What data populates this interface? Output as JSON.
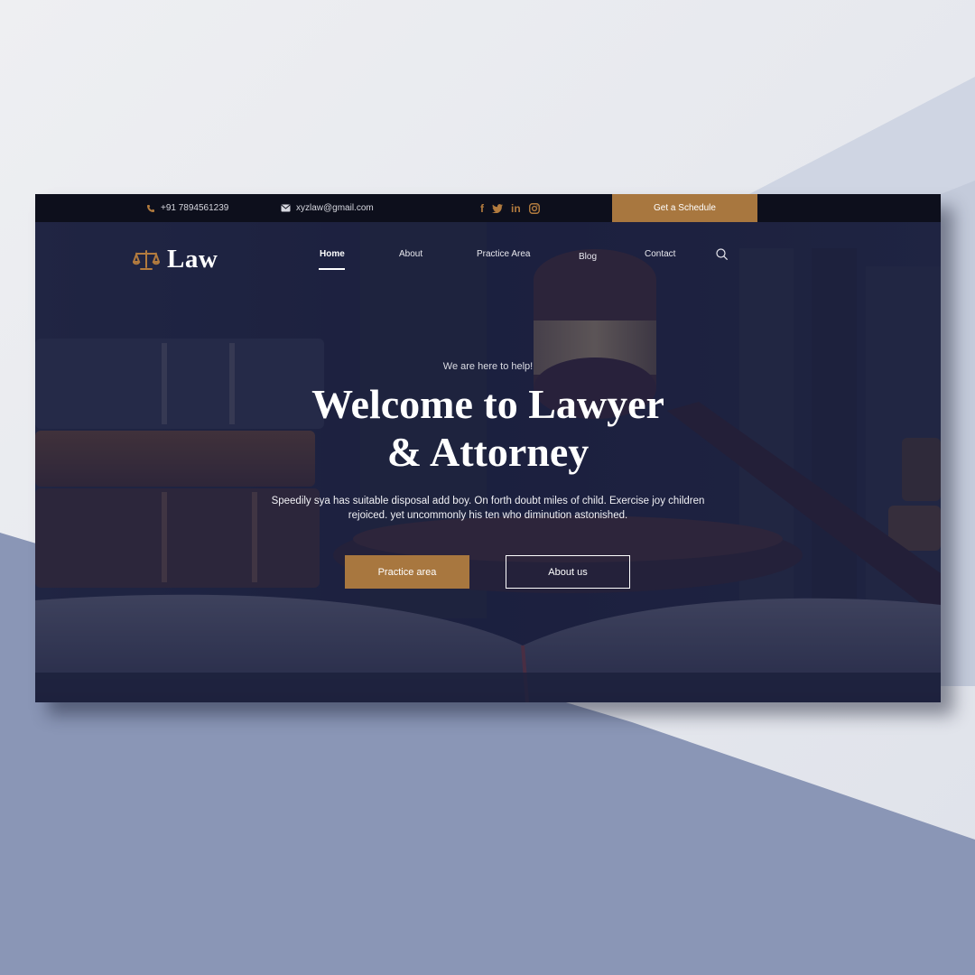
{
  "topbar": {
    "phone": "+91 7894561239",
    "email": "xyzlaw@gmail.com",
    "social": [
      {
        "name": "facebook",
        "glyph": "f"
      },
      {
        "name": "twitter",
        "glyph": "t"
      },
      {
        "name": "linkedin",
        "glyph": "in"
      },
      {
        "name": "instagram",
        "glyph": ""
      }
    ],
    "schedule_label": "Get a Schedule"
  },
  "brand": {
    "logo_text": "Law",
    "accent_color": "#a8773f",
    "dark_color": "#1b1f3c"
  },
  "nav": {
    "items": [
      {
        "label": "Home",
        "active": true
      },
      {
        "label": "About",
        "active": false
      },
      {
        "label": "Practice Area",
        "active": false
      },
      {
        "label": "Blog",
        "active": false
      },
      {
        "label": "Contact",
        "active": false
      }
    ]
  },
  "hero": {
    "eyebrow": "We are here to help!",
    "title_line1": "Welcome to Lawyer",
    "title_line2": "& Attorney",
    "description": "Speedily sya has suitable disposal add boy. On forth doubt miles of child. Exercise joy children rejoiced. yet uncommonly his ten who diminution astonished.",
    "primary_button": "Practice area",
    "secondary_button": "About us"
  },
  "icons": {
    "phone": "phone-icon",
    "mail": "mail-icon",
    "search": "search-icon",
    "logo": "scales-icon"
  }
}
